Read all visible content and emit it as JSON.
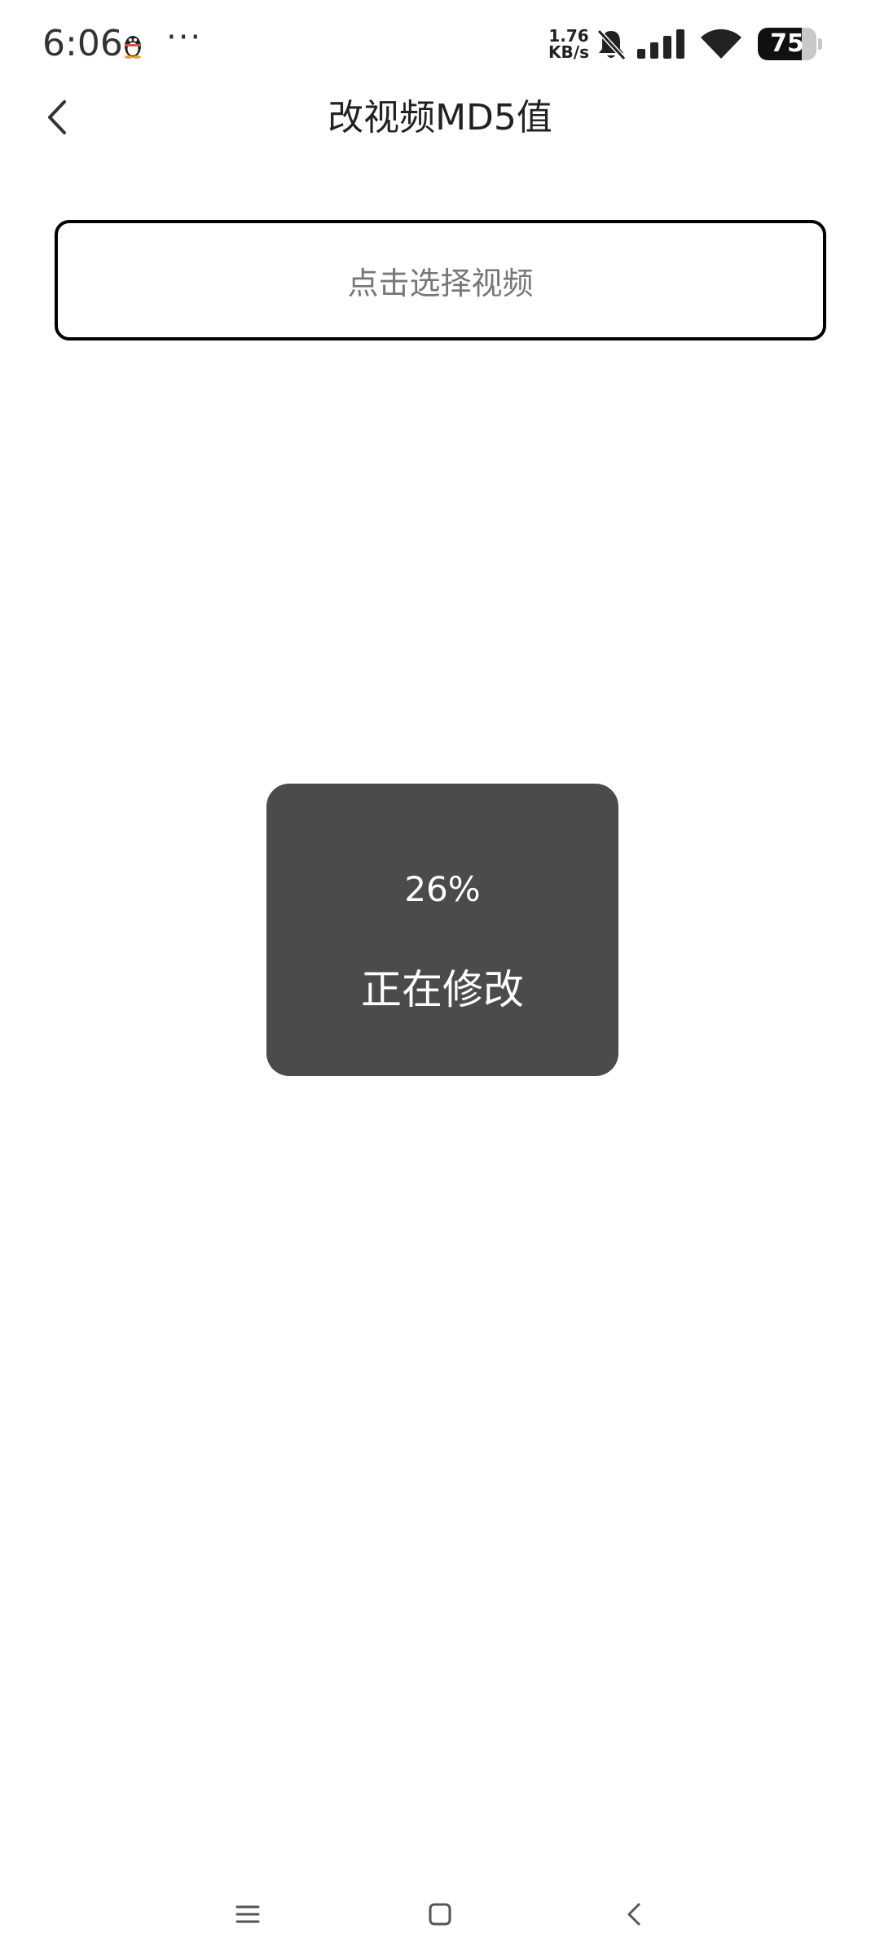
{
  "status_bar": {
    "time": "6:06",
    "more": "···",
    "net_speed_value": "1.76",
    "net_speed_unit": "KB/s",
    "battery_level": 75,
    "battery_text": "75",
    "icons": [
      "qq-penguin-icon",
      "bell-muted-icon",
      "signal-icon",
      "wifi-icon",
      "battery-icon"
    ]
  },
  "header": {
    "title": "改视频MD5值",
    "back_icon": "chevron-left-icon"
  },
  "main": {
    "select_button_label": "点击选择视频"
  },
  "dialog": {
    "percent_text": "26%",
    "status_text": "正在修改",
    "background_color": "#4b4b4b"
  },
  "nav_bar": {
    "icons": [
      "menu-icon",
      "home-icon",
      "back-icon"
    ]
  }
}
